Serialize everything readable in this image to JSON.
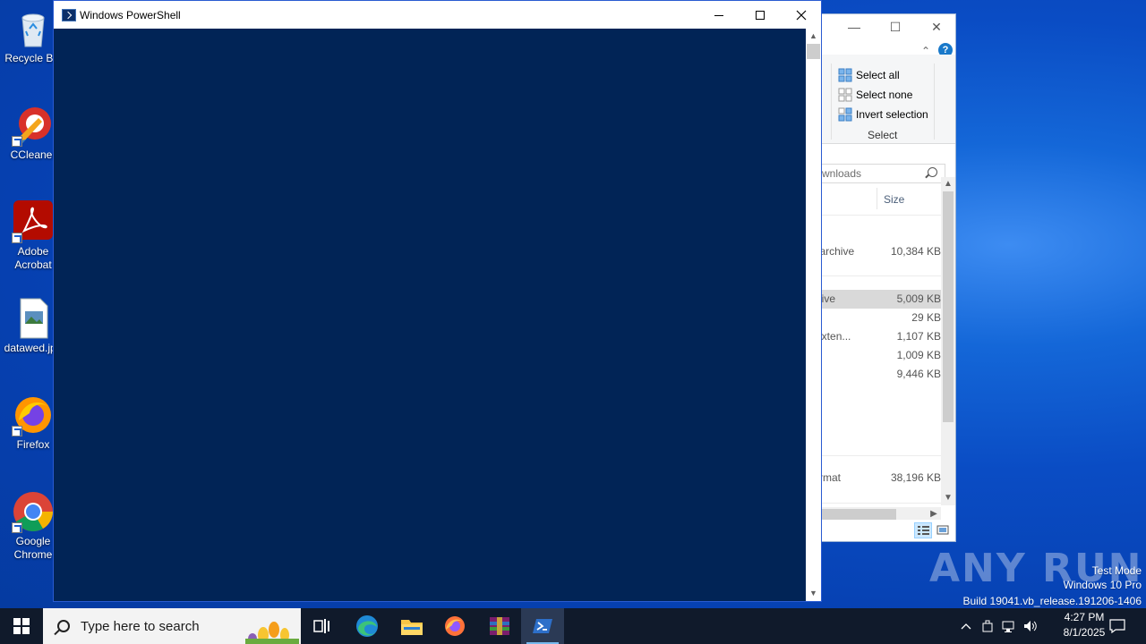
{
  "desktop": {
    "icons": [
      {
        "label": "Recycle Bin"
      },
      {
        "label": "CCleaner"
      },
      {
        "label": "Adobe Acrobat"
      },
      {
        "label": "datawed.jpg"
      },
      {
        "label": "Firefox"
      },
      {
        "label": "Google Chrome"
      }
    ]
  },
  "explorer": {
    "ribbon": {
      "select_all": "Select all",
      "select_none": "Select none",
      "invert_selection": "Invert selection",
      "group_label": "Select"
    },
    "search_placeholder": "wnloads",
    "column_size": "Size",
    "rows": [
      {
        "type": "IP archive",
        "size": "10,384 KB"
      },
      {
        "type": "rchive",
        "size": "5,009 KB"
      },
      {
        "type": "",
        "size": "29 KB"
      },
      {
        "type": "n exten...",
        "size": "1,107 KB"
      },
      {
        "type": "",
        "size": "1,009 KB"
      },
      {
        "type": "n",
        "size": "9,446 KB"
      },
      {
        "type": "Format",
        "size": "38,196 KB"
      }
    ]
  },
  "powershell": {
    "title": "Windows PowerShell",
    "console_bg": "#012456"
  },
  "watermark": {
    "brand": "ANY RUN",
    "line1": "Test Mode",
    "line2": "Windows 10 Pro",
    "line3": "Build 19041.vb_release.191206-1406"
  },
  "taskbar": {
    "search_placeholder": "Type here to search",
    "apps": [
      "task-view",
      "edge",
      "file-explorer",
      "firefox",
      "winrar",
      "powershell"
    ],
    "time": "4:27 PM",
    "date": "8/1/2025"
  }
}
